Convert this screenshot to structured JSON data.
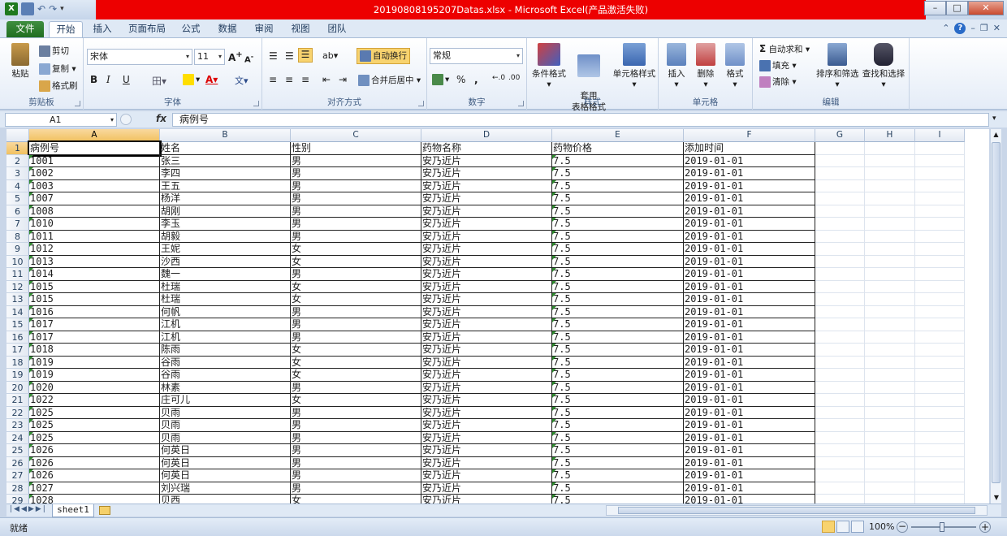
{
  "window": {
    "title": "20190808195207Datas.xlsx  -  Microsoft Excel(产品激活失败)"
  },
  "tabs": [
    "文件",
    "开始",
    "插入",
    "页面布局",
    "公式",
    "数据",
    "审阅",
    "视图",
    "团队"
  ],
  "ribbon": {
    "clipboard": {
      "paste": "粘贴",
      "cut": "剪切",
      "copy": "复制",
      "format_painter": "格式刷",
      "label": "剪贴板"
    },
    "font": {
      "name": "宋体",
      "size": "11",
      "bold": "B",
      "italic": "I",
      "underline": "U",
      "phonetic": "文",
      "label": "字体"
    },
    "alignment": {
      "wrap": "自动换行",
      "merge": "合并后居中",
      "label": "对齐方式"
    },
    "number": {
      "format": "常规",
      "percent": "%",
      "comma": ",",
      "label": "数字"
    },
    "styles": {
      "conditional": "条件格式",
      "table_format": "套用\n表格格式",
      "cell_styles": "单元格样式",
      "label": "样式"
    },
    "cells": {
      "insert": "插入",
      "delete": "删除",
      "format": "格式",
      "label": "单元格"
    },
    "editing": {
      "autosum": "自动求和",
      "fill": "填充",
      "clear": "清除",
      "sort": "排序和筛选",
      "find": "查找和选择",
      "label": "编辑"
    }
  },
  "formula_bar": {
    "name_box": "A1",
    "fx": "fx",
    "content": "病例号"
  },
  "columns": [
    "A",
    "B",
    "C",
    "D",
    "E",
    "F",
    "G",
    "H",
    "I"
  ],
  "headers": [
    "病例号",
    "姓名",
    "性别",
    "药物名称",
    "药物价格",
    "添加时间"
  ],
  "rows": [
    [
      "1001",
      "张三",
      "男",
      "安乃近片",
      "7.5",
      "2019-01-01"
    ],
    [
      "1002",
      "李四",
      "男",
      "安乃近片",
      "7.5",
      "2019-01-01"
    ],
    [
      "1003",
      "王五",
      "男",
      "安乃近片",
      "7.5",
      "2019-01-01"
    ],
    [
      "1007",
      "杨洋",
      "男",
      "安乃近片",
      "7.5",
      "2019-01-01"
    ],
    [
      "1008",
      "胡刚",
      "男",
      "安乃近片",
      "7.5",
      "2019-01-01"
    ],
    [
      "1010",
      "李玉",
      "男",
      "安乃近片",
      "7.5",
      "2019-01-01"
    ],
    [
      "1011",
      "胡毅",
      "男",
      "安乃近片",
      "7.5",
      "2019-01-01"
    ],
    [
      "1012",
      "王妮",
      "女",
      "安乃近片",
      "7.5",
      "2019-01-01"
    ],
    [
      "1013",
      "沙西",
      "女",
      "安乃近片",
      "7.5",
      "2019-01-01"
    ],
    [
      "1014",
      "魏一",
      "男",
      "安乃近片",
      "7.5",
      "2019-01-01"
    ],
    [
      "1015",
      "杜瑞",
      "女",
      "安乃近片",
      "7.5",
      "2019-01-01"
    ],
    [
      "1015",
      "杜瑞",
      "女",
      "安乃近片",
      "7.5",
      "2019-01-01"
    ],
    [
      "1016",
      "何帆",
      "男",
      "安乃近片",
      "7.5",
      "2019-01-01"
    ],
    [
      "1017",
      "江机",
      "男",
      "安乃近片",
      "7.5",
      "2019-01-01"
    ],
    [
      "1017",
      "江机",
      "男",
      "安乃近片",
      "7.5",
      "2019-01-01"
    ],
    [
      "1018",
      "陈雨",
      "女",
      "安乃近片",
      "7.5",
      "2019-01-01"
    ],
    [
      "1019",
      "谷雨",
      "女",
      "安乃近片",
      "7.5",
      "2019-01-01"
    ],
    [
      "1019",
      "谷雨",
      "女",
      "安乃近片",
      "7.5",
      "2019-01-01"
    ],
    [
      "1020",
      "林素",
      "男",
      "安乃近片",
      "7.5",
      "2019-01-01"
    ],
    [
      "1022",
      "庄可儿",
      "女",
      "安乃近片",
      "7.5",
      "2019-01-01"
    ],
    [
      "1025",
      "贝雨",
      "男",
      "安乃近片",
      "7.5",
      "2019-01-01"
    ],
    [
      "1025",
      "贝雨",
      "男",
      "安乃近片",
      "7.5",
      "2019-01-01"
    ],
    [
      "1025",
      "贝雨",
      "男",
      "安乃近片",
      "7.5",
      "2019-01-01"
    ],
    [
      "1026",
      "何英日",
      "男",
      "安乃近片",
      "7.5",
      "2019-01-01"
    ],
    [
      "1026",
      "何英日",
      "男",
      "安乃近片",
      "7.5",
      "2019-01-01"
    ],
    [
      "1026",
      "何英日",
      "男",
      "安乃近片",
      "7.5",
      "2019-01-01"
    ],
    [
      "1027",
      "刘兴瑞",
      "男",
      "安乃近片",
      "7.5",
      "2019-01-01"
    ],
    [
      "1028",
      "贝西",
      "女",
      "安乃近片",
      "7.5",
      "2019-01-01"
    ]
  ],
  "sheet_tab": "sheet1",
  "status": {
    "ready": "就绪",
    "zoom": "100%"
  }
}
